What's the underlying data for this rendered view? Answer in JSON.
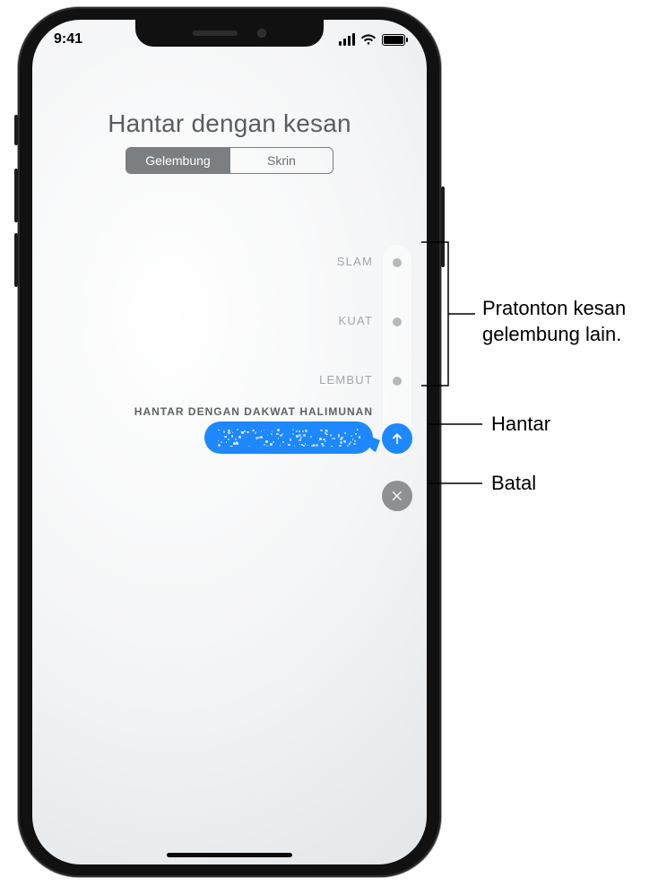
{
  "status": {
    "time": "9:41"
  },
  "title": "Hantar dengan kesan",
  "segmented": {
    "bubble": "Gelembung",
    "screen": "Skrin"
  },
  "effects": {
    "slam": "SLAM",
    "loud": "KUAT",
    "gentle": "LEMBUT",
    "ink": "HANTAR DENGAN DAKWAT HALIMUNAN"
  },
  "callouts": {
    "preview_line1": "Pratonton kesan",
    "preview_line2": "gelembung lain.",
    "send": "Hantar",
    "cancel": "Batal"
  }
}
